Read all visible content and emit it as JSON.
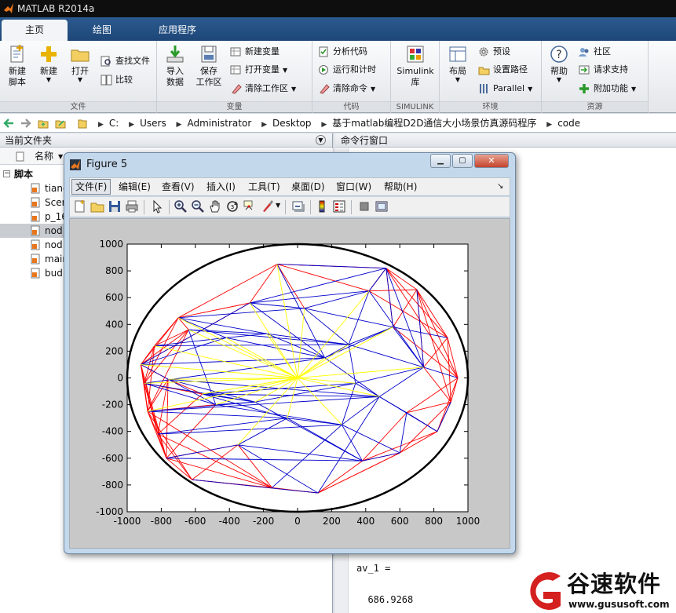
{
  "app": {
    "title": "MATLAB R2014a"
  },
  "tabs": [
    "主页",
    "绘图",
    "应用程序"
  ],
  "ribbon": {
    "file": {
      "label": "文件",
      "new_script": [
        "新建",
        "脚本"
      ],
      "new": "新建",
      "open": "打开",
      "find_files": "查找文件",
      "compare": "比较"
    },
    "variable": {
      "label": "变量",
      "import": [
        "导入",
        "数据"
      ],
      "save": [
        "保存",
        "工作区"
      ],
      "new_var": "新建变量",
      "open_var": "打开变量",
      "clear_ws": "清除工作区"
    },
    "code": {
      "label": "代码",
      "analyze": "分析代码",
      "run_time": "运行和计时",
      "clear_cmd": "清除命令"
    },
    "simulink": {
      "label": "SIMULINK",
      "lib": [
        "Simulink",
        "库"
      ]
    },
    "env": {
      "label": "环境",
      "layout": "布局",
      "prefs": "预设",
      "setpath": "设置路径",
      "parallel": "Parallel"
    },
    "resources": {
      "label": "资源",
      "help": "帮助",
      "community": "社区",
      "support": "请求支持",
      "addons": "附加功能"
    }
  },
  "address": [
    "C:",
    "Users",
    "Administrator",
    "Desktop",
    "基于matlab编程D2D通信大小场景仿真源码程序",
    "code"
  ],
  "current_folder": {
    "title": "当前文件夹",
    "name_col": "名称",
    "group": "脚本",
    "files": [
      "tianc",
      "Scen",
      "p_16",
      "nod",
      "nod",
      "main",
      "bud"
    ],
    "selected_index": 3
  },
  "command_window": {
    "title": "命令行窗口",
    "lines": [
      "av_1 =",
      "",
      "  686.9268"
    ]
  },
  "figure": {
    "title": "Figure 5",
    "menu": [
      "文件(F)",
      "编辑(E)",
      "查看(V)",
      "插入(I)",
      "工具(T)",
      "桌面(D)",
      "窗口(W)",
      "帮助(H)"
    ],
    "active_menu_index": 0
  },
  "chart_data": {
    "type": "line",
    "xlim": [
      -1000,
      1000
    ],
    "ylim": [
      -1000,
      1000
    ],
    "xticks": [
      -1000,
      -800,
      -600,
      -400,
      -200,
      0,
      200,
      400,
      600,
      800,
      1000
    ],
    "yticks": [
      -1000,
      -800,
      -600,
      -400,
      -200,
      0,
      200,
      400,
      600,
      800,
      1000
    ],
    "circle": {
      "cx": 0,
      "cy": 0,
      "r": 1000,
      "color": "#000000"
    },
    "nodes": [
      [
        -920,
        100
      ],
      [
        -900,
        -40
      ],
      [
        -880,
        -250
      ],
      [
        -820,
        -420
      ],
      [
        -770,
        -600
      ],
      [
        -700,
        450
      ],
      [
        -640,
        360
      ],
      [
        -620,
        -760
      ],
      [
        -560,
        -120
      ],
      [
        -480,
        -200
      ],
      [
        -420,
        300
      ],
      [
        -350,
        -500
      ],
      [
        -280,
        560
      ],
      [
        -250,
        -180
      ],
      [
        -180,
        330
      ],
      [
        -150,
        -820
      ],
      [
        -120,
        850
      ],
      [
        -60,
        -300
      ],
      [
        0,
        0
      ],
      [
        40,
        520
      ],
      [
        120,
        -860
      ],
      [
        160,
        150
      ],
      [
        260,
        -350
      ],
      [
        300,
        250
      ],
      [
        380,
        -620
      ],
      [
        420,
        650
      ],
      [
        480,
        -140
      ],
      [
        520,
        820
      ],
      [
        560,
        380
      ],
      [
        600,
        -560
      ],
      [
        640,
        -260
      ],
      [
        700,
        660
      ],
      [
        740,
        80
      ],
      [
        820,
        -400
      ],
      [
        880,
        300
      ],
      [
        900,
        -180
      ],
      [
        940,
        0
      ],
      [
        -840,
        240
      ],
      [
        -760,
        -10
      ],
      [
        340,
        -40
      ]
    ],
    "series": [
      {
        "color": "#ff0000",
        "edges": [
          [
            0,
            1
          ],
          [
            0,
            2
          ],
          [
            0,
            3
          ],
          [
            0,
            4
          ],
          [
            1,
            2
          ],
          [
            1,
            3
          ],
          [
            1,
            4
          ],
          [
            2,
            3
          ],
          [
            2,
            4
          ],
          [
            3,
            4
          ],
          [
            0,
            37
          ],
          [
            37,
            1
          ],
          [
            37,
            2
          ],
          [
            38,
            0
          ],
          [
            38,
            3
          ],
          [
            38,
            4
          ],
          [
            5,
            0
          ],
          [
            5,
            1
          ],
          [
            5,
            37
          ],
          [
            5,
            6
          ],
          [
            6,
            1
          ],
          [
            6,
            2
          ],
          [
            7,
            3
          ],
          [
            7,
            4
          ],
          [
            7,
            2
          ],
          [
            7,
            11
          ],
          [
            7,
            15
          ],
          [
            15,
            3
          ],
          [
            15,
            4
          ],
          [
            15,
            11
          ],
          [
            16,
            12
          ],
          [
            16,
            5
          ],
          [
            16,
            19
          ],
          [
            16,
            27
          ],
          [
            27,
            31
          ],
          [
            27,
            25
          ],
          [
            27,
            34
          ],
          [
            31,
            34
          ],
          [
            31,
            28
          ],
          [
            31,
            36
          ],
          [
            34,
            36
          ],
          [
            34,
            32
          ],
          [
            36,
            35
          ],
          [
            35,
            33
          ],
          [
            33,
            29
          ],
          [
            29,
            24
          ],
          [
            29,
            20
          ],
          [
            20,
            15
          ],
          [
            20,
            24
          ],
          [
            24,
            33
          ],
          [
            35,
            32
          ],
          [
            36,
            33
          ],
          [
            34,
            35
          ],
          [
            31,
            35
          ],
          [
            27,
            36
          ],
          [
            25,
            34
          ],
          [
            20,
            7
          ],
          [
            15,
            2
          ],
          [
            4,
            11
          ],
          [
            12,
            5
          ],
          [
            12,
            0
          ],
          [
            3,
            8
          ],
          [
            2,
            9
          ],
          [
            1,
            8
          ],
          [
            4,
            9
          ],
          [
            0,
            6
          ],
          [
            37,
            6
          ],
          [
            38,
            2
          ],
          [
            38,
            8
          ],
          [
            29,
            35
          ],
          [
            33,
            30
          ],
          [
            30,
            36
          ],
          [
            30,
            35
          ],
          [
            24,
            30
          ],
          [
            20,
            29
          ],
          [
            27,
            28
          ],
          [
            28,
            36
          ],
          [
            31,
            32
          ],
          [
            25,
            31
          ],
          [
            16,
            25
          ]
        ]
      },
      {
        "color": "#0000cc",
        "edges": [
          [
            0,
            9
          ],
          [
            0,
            10
          ],
          [
            1,
            9
          ],
          [
            1,
            13
          ],
          [
            2,
            13
          ],
          [
            2,
            17
          ],
          [
            3,
            17
          ],
          [
            4,
            11
          ],
          [
            5,
            10
          ],
          [
            5,
            14
          ],
          [
            6,
            14
          ],
          [
            6,
            9
          ],
          [
            8,
            13
          ],
          [
            8,
            17
          ],
          [
            9,
            13
          ],
          [
            10,
            14
          ],
          [
            10,
            21
          ],
          [
            11,
            17
          ],
          [
            11,
            20
          ],
          [
            12,
            19
          ],
          [
            12,
            25
          ],
          [
            14,
            21
          ],
          [
            16,
            27
          ],
          [
            17,
            22
          ],
          [
            19,
            25
          ],
          [
            19,
            23
          ],
          [
            21,
            23
          ],
          [
            21,
            26
          ],
          [
            22,
            26
          ],
          [
            22,
            24
          ],
          [
            23,
            28
          ],
          [
            23,
            25
          ],
          [
            24,
            29
          ],
          [
            25,
            27
          ],
          [
            26,
            30
          ],
          [
            26,
            32
          ],
          [
            27,
            28
          ],
          [
            28,
            32
          ],
          [
            28,
            34
          ],
          [
            29,
            30
          ],
          [
            30,
            33
          ],
          [
            31,
            32
          ],
          [
            32,
            36
          ],
          [
            33,
            35
          ],
          [
            37,
            10
          ],
          [
            38,
            13
          ],
          [
            1,
            21
          ],
          [
            2,
            26
          ],
          [
            3,
            22
          ],
          [
            4,
            24
          ],
          [
            7,
            20
          ],
          [
            15,
            22
          ],
          [
            16,
            21
          ],
          [
            12,
            21
          ],
          [
            5,
            19
          ],
          [
            6,
            23
          ],
          [
            0,
            21
          ],
          [
            37,
            23
          ],
          [
            38,
            26
          ],
          [
            8,
            26
          ],
          [
            9,
            22
          ],
          [
            13,
            24
          ],
          [
            17,
            24
          ],
          [
            20,
            26
          ],
          [
            23,
            32
          ],
          [
            25,
            32
          ],
          [
            27,
            32
          ],
          [
            19,
            28
          ],
          [
            14,
            23
          ],
          [
            11,
            24
          ],
          [
            22,
            29
          ],
          [
            26,
            33
          ],
          [
            21,
            28
          ],
          [
            0,
            12
          ],
          [
            12,
            27
          ],
          [
            39,
            26
          ],
          [
            39,
            32
          ],
          [
            39,
            22
          ],
          [
            39,
            23
          ],
          [
            8,
            39
          ],
          [
            13,
            39
          ]
        ]
      },
      {
        "color": "#ffff00",
        "edges": [
          [
            18,
            0
          ],
          [
            18,
            1
          ],
          [
            18,
            2
          ],
          [
            18,
            5
          ],
          [
            18,
            6
          ],
          [
            18,
            8
          ],
          [
            18,
            9
          ],
          [
            18,
            10
          ],
          [
            18,
            12
          ],
          [
            18,
            13
          ],
          [
            18,
            14
          ],
          [
            18,
            16
          ],
          [
            18,
            17
          ],
          [
            18,
            19
          ],
          [
            18,
            21
          ],
          [
            18,
            22
          ],
          [
            18,
            23
          ],
          [
            18,
            25
          ],
          [
            18,
            26
          ],
          [
            18,
            28
          ],
          [
            18,
            37
          ],
          [
            18,
            38
          ],
          [
            18,
            39
          ],
          [
            18,
            32
          ],
          [
            18,
            11
          ]
        ]
      }
    ]
  }
}
